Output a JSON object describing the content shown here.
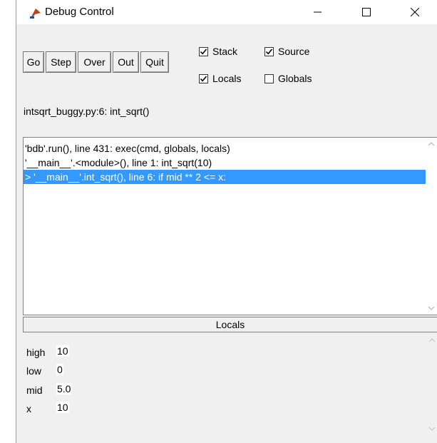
{
  "window": {
    "title": "Debug Control"
  },
  "toolbar": {
    "buttons": [
      {
        "label": "Go"
      },
      {
        "label": "Step"
      },
      {
        "label": "Over"
      },
      {
        "label": "Out"
      },
      {
        "label": "Quit"
      }
    ],
    "checks": {
      "stack": {
        "label": "Stack",
        "checked": true
      },
      "source": {
        "label": "Source",
        "checked": true
      },
      "locals": {
        "label": "Locals",
        "checked": true
      },
      "globals": {
        "label": "Globals",
        "checked": false
      }
    }
  },
  "status": {
    "location": "intsqrt_buggy.py:6: int_sqrt()"
  },
  "stack": {
    "frames": [
      {
        "text": "'bdb'.run(), line 431: exec(cmd, globals, locals)",
        "selected": false
      },
      {
        "text": "'__main__'.<module>(), line 1: int_sqrt(10)",
        "selected": false
      },
      {
        "text": "> '__main__'.int_sqrt(), line 6: if mid ** 2 <= x:",
        "selected": true
      }
    ]
  },
  "locals": {
    "header": "Locals",
    "vars": [
      {
        "name": "high",
        "value": "10"
      },
      {
        "name": "low",
        "value": "0"
      },
      {
        "name": "mid",
        "value": "5.0"
      },
      {
        "name": "x",
        "value": "10"
      }
    ]
  },
  "colors": {
    "selection": "#3399ff",
    "window_bg": "#f0f0f0"
  }
}
